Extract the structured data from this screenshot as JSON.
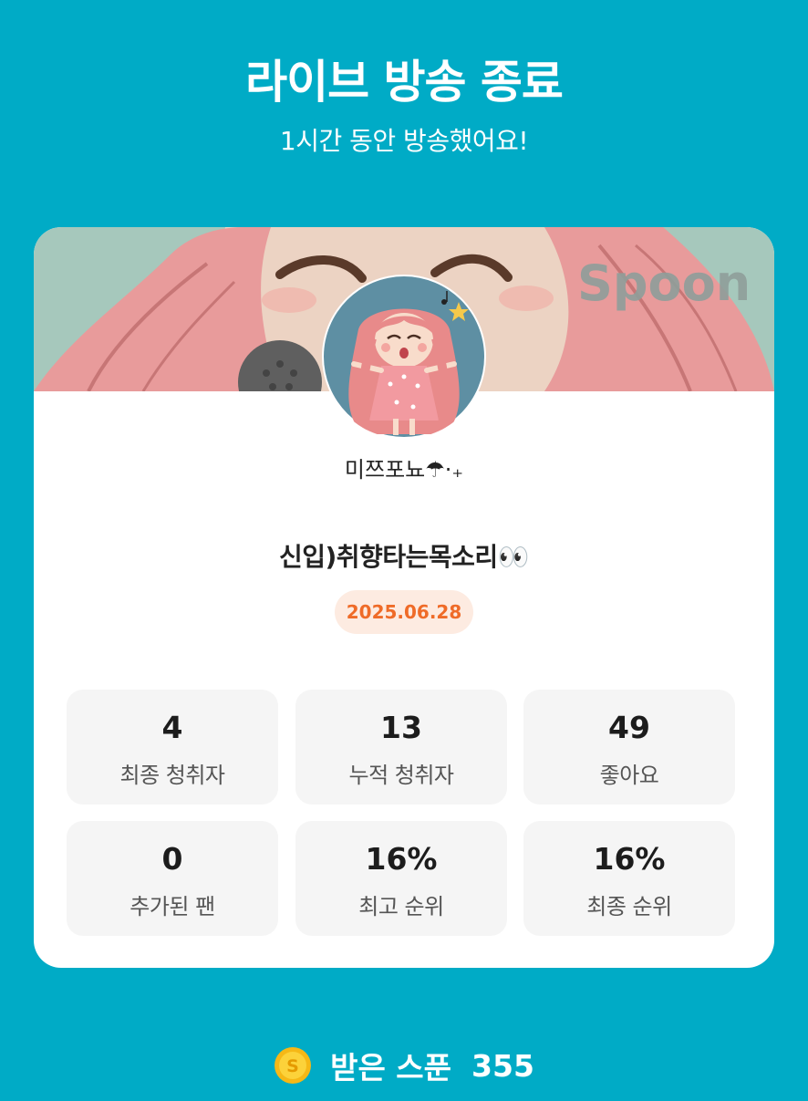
{
  "header": {
    "title": "라이브 방송 종료",
    "subtitle": "1시간 동안 방송했어요!"
  },
  "card": {
    "banner_watermark": "Spoon",
    "username": "미쯔포뇨☂︎·₊",
    "broadcast_title": "신입)취향타는목소리👀",
    "date": "2025.06.28",
    "stats": [
      {
        "value": "4",
        "label": "최종 청취자"
      },
      {
        "value": "13",
        "label": "누적 청취자"
      },
      {
        "value": "49",
        "label": "좋아요"
      },
      {
        "value": "0",
        "label": "추가된 팬"
      },
      {
        "value": "16%",
        "label": "최고 순위"
      },
      {
        "value": "16%",
        "label": "최종 순위"
      }
    ]
  },
  "footer": {
    "coin_icon": "spoon-coin-icon",
    "coin_letter": "S",
    "label": "받은 스푼",
    "value": "355"
  },
  "colors": {
    "background": "#00abc6",
    "card": "#ffffff",
    "stat_box": "#f5f5f5",
    "date_badge_bg": "#fdebe1",
    "date_badge_text": "#ef6b28",
    "coin": "#f6b816"
  }
}
